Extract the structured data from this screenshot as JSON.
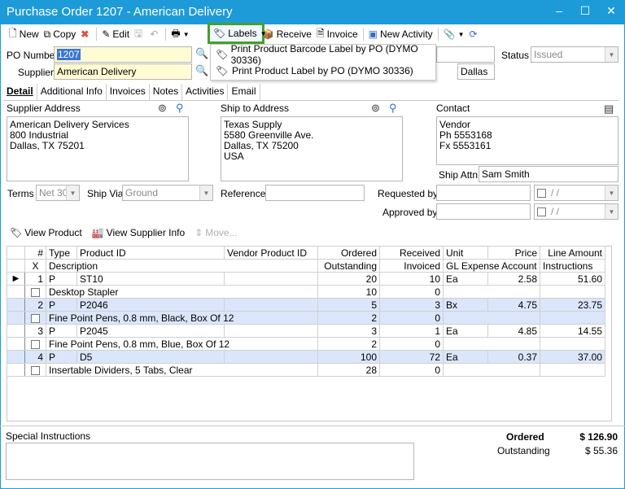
{
  "window": {
    "title": "Purchase Order 1207 - American Delivery",
    "min": "–",
    "max": "☐",
    "close": "✕"
  },
  "toolbar": {
    "new": "New",
    "copy": "Copy",
    "edit": "Edit",
    "labels": "Labels",
    "receive": "Receive",
    "invoice": "Invoice",
    "new_activity": "New Activity"
  },
  "labels_menu": [
    {
      "label": "Print Product Barcode Label by PO (DYMO 30336)"
    },
    {
      "label": "Print Product Label by PO (DYMO 30336)"
    }
  ],
  "header": {
    "po_number_label": "PO Number",
    "po_number": "1207",
    "supplier_label": "Supplier",
    "supplier": "American Delivery",
    "status_label": "Status",
    "status": "Issued",
    "ship_city": "Dallas"
  },
  "tabs": [
    "Detail",
    "Additional Info",
    "Invoices",
    "Notes",
    "Activities",
    "Email"
  ],
  "detail": {
    "supplier_address_label": "Supplier Address",
    "supplier_address": "American Delivery Services\n800 Industrial\nDallas, TX 75201",
    "ship_to_label": "Ship to Address",
    "ship_to": "Texas Supply\n5580 Greenville Ave.\nDallas, TX 75200\nUSA",
    "contact_label": "Contact",
    "contact": "Vendor\nPh 5553168\nFx 5553161",
    "ship_attn_label": "Ship Attn",
    "ship_attn": "Sam Smith",
    "terms_label": "Terms",
    "terms": "Net 30",
    "ship_via_label": "Ship Via",
    "ship_via": "Ground",
    "reference_label": "Reference",
    "reference": "",
    "requested_by_label": "Requested by",
    "approved_by_label": "Approved by",
    "date_placeholder": "/ /"
  },
  "grid_tools": {
    "view_product": "View Product",
    "view_supplier": "View Supplier Info",
    "move": "Move..."
  },
  "grid": {
    "header1": [
      "#",
      "Type",
      "Product ID",
      "Vendor Product ID",
      "Ordered",
      "Received",
      "Unit",
      "Price",
      "Line Amount"
    ],
    "header2": [
      "X",
      "Description",
      "Outstanding",
      "Invoiced",
      "GL Expense Account",
      "Instructions"
    ],
    "rows": [
      {
        "num": "1",
        "type": "P",
        "product_id": "ST10",
        "vendor_pid": "",
        "ordered": "20",
        "received": "10",
        "unit": "Ea",
        "price": "2.58",
        "line_amount": "51.60",
        "description": "Desktop Stapler",
        "outstanding": "10",
        "invoiced": "0"
      },
      {
        "num": "2",
        "type": "P",
        "product_id": "P2046",
        "vendor_pid": "",
        "ordered": "5",
        "received": "3",
        "unit": "Bx",
        "price": "4.75",
        "line_amount": "23.75",
        "description": "Fine Point Pens, 0.8 mm, Black, Box Of 12",
        "outstanding": "2",
        "invoiced": "0"
      },
      {
        "num": "3",
        "type": "P",
        "product_id": "P2045",
        "vendor_pid": "",
        "ordered": "3",
        "received": "1",
        "unit": "Ea",
        "price": "4.85",
        "line_amount": "14.55",
        "description": "Fine Point Pens, 0.8 mm, Blue, Box Of 12",
        "outstanding": "2",
        "invoiced": "0"
      },
      {
        "num": "4",
        "type": "P",
        "product_id": "D5",
        "vendor_pid": "",
        "ordered": "100",
        "received": "72",
        "unit": "Ea",
        "price": "0.37",
        "line_amount": "37.00",
        "description": "Insertable Dividers, 5 Tabs, Clear",
        "outstanding": "28",
        "invoiced": "0"
      }
    ]
  },
  "footer": {
    "special_instructions_label": "Special Instructions",
    "ordered_label": "Ordered",
    "ordered_total": "$ 126.90",
    "outstanding_label": "Outstanding",
    "outstanding_total": "$ 55.36"
  }
}
